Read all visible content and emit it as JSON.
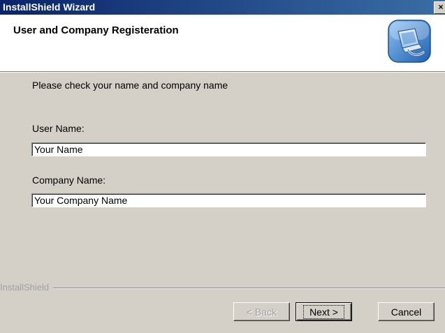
{
  "window": {
    "title": "InstallShield Wizard",
    "close_glyph": "×"
  },
  "header": {
    "title": "User and Company Registeration",
    "icon": "installer-computer-icon"
  },
  "main": {
    "subtitle": "Please check your name and company name",
    "user_name_label": "User Name:",
    "user_name_value": "Your Name",
    "company_name_label": "Company Name:",
    "company_name_value": "Your Company Name"
  },
  "footer": {
    "brand": "InstallShield",
    "back_label": "< Back",
    "next_label": "Next >",
    "cancel_label": "Cancel"
  },
  "colors": {
    "dialog_bg": "#d4d0c8",
    "titlebar_start": "#0a246a",
    "titlebar_end": "#3a6ea5",
    "header_bg": "#ffffff"
  }
}
